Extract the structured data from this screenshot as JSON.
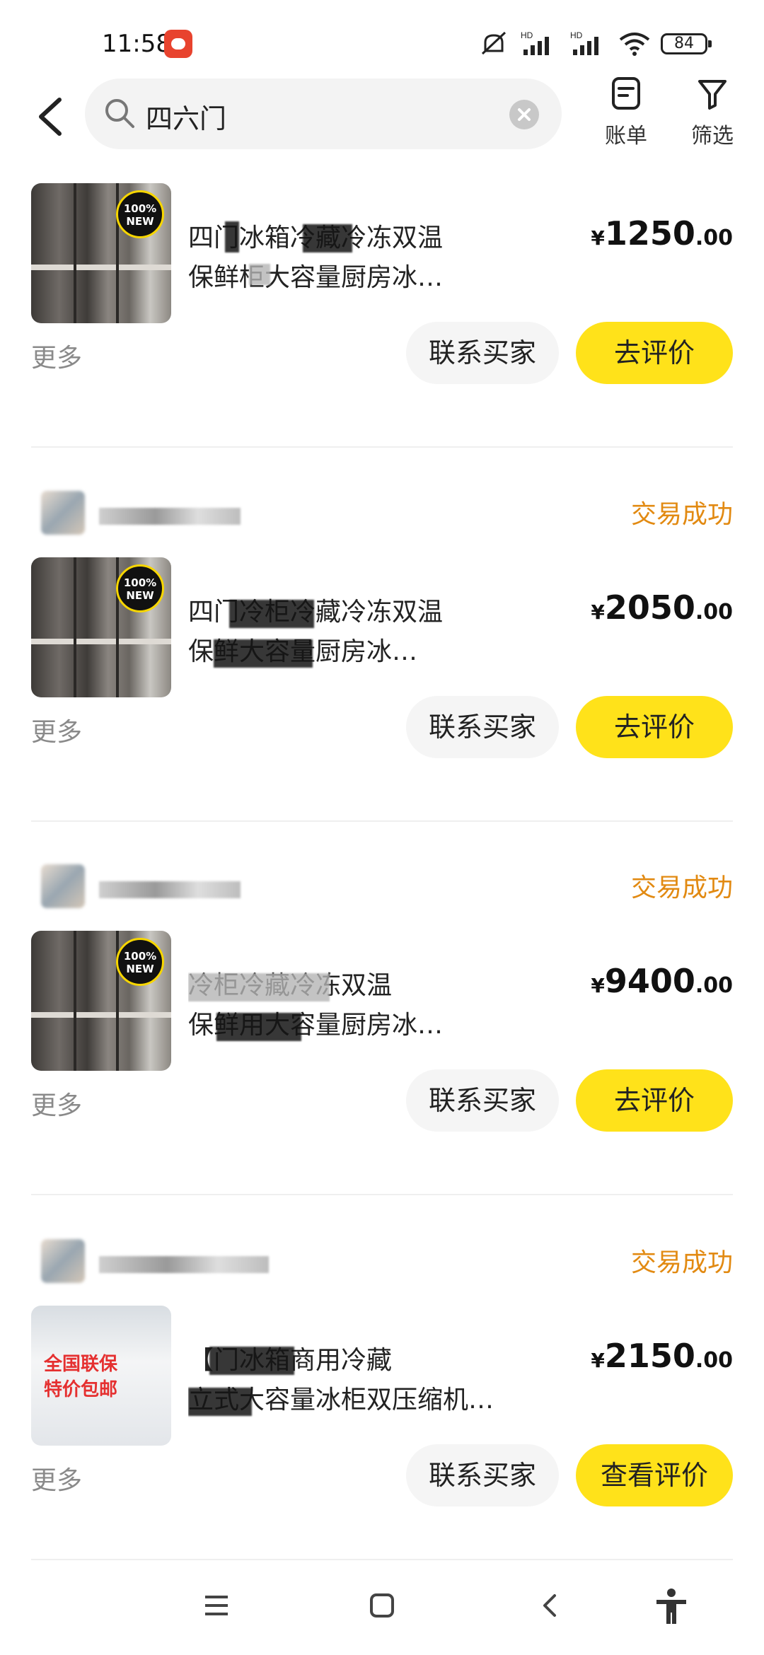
{
  "status_bar": {
    "time": "11:58",
    "battery": "84",
    "network_1": "HD",
    "network_2": "HD"
  },
  "header": {
    "search_value": "四六门",
    "bill_label": "账单",
    "filter_label": "筛选"
  },
  "orders": [
    {
      "status": "",
      "title_line1": "四门冰箱冷藏冷冻双温",
      "title_line2": "保鲜柜大容量厨房冰…",
      "price_currency": "¥",
      "price_int": "1250",
      "price_dec": ".00",
      "more": "更多",
      "contact_label": "联系买家",
      "review_label": "去评价",
      "badge": "100% NEW"
    },
    {
      "status": "交易成功",
      "title_line1": "四门冷柜冷藏冷冻双温",
      "title_line2": "保鲜大容量厨房冰…",
      "price_currency": "¥",
      "price_int": "2050",
      "price_dec": ".00",
      "more": "更多",
      "contact_label": "联系买家",
      "review_label": "去评价",
      "badge": "100% NEW"
    },
    {
      "status": "交易成功",
      "title_line1": "冷柜冷藏冷冻双温",
      "title_line2": "保鲜用大容量厨房冰…",
      "price_currency": "¥",
      "price_int": "9400",
      "price_dec": ".00",
      "more": "更多",
      "contact_label": "联系买家",
      "review_label": "去评价",
      "badge": "100% NEW"
    },
    {
      "status": "交易成功",
      "title_line1": "【门冰箱商用冷藏",
      "title_line2": "立式大容量冰柜双压缩机…",
      "price_currency": "¥",
      "price_int": "2150",
      "price_dec": ".00",
      "more": "更多",
      "contact_label": "联系买家",
      "review_label": "查看评价",
      "promo_line1": "全国联保",
      "promo_line2": "特价包邮"
    }
  ],
  "colors": {
    "accent_yellow": "#ffe21a",
    "status_orange": "#e28a12"
  }
}
